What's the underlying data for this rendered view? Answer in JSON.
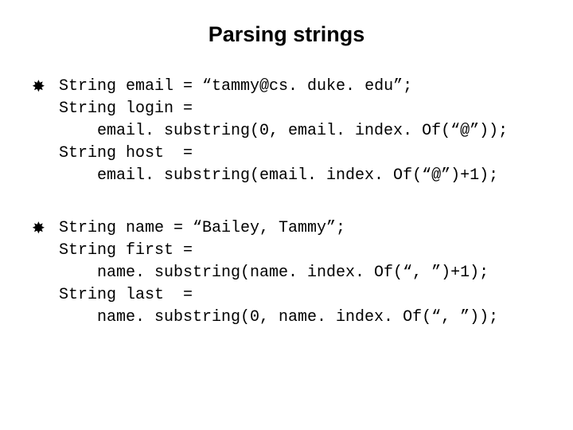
{
  "title": "Parsing strings",
  "block1": {
    "l1": "String email = “tammy@cs. duke. edu”;",
    "l2": "String login =",
    "l3": "email. substring(0, email. index. Of(“@”));",
    "l4": "String host  =",
    "l5": "email. substring(email. index. Of(“@”)+1);"
  },
  "block2": {
    "l1": "String name = “Bailey, Tammy”;",
    "l2": "String first =",
    "l3": "name. substring(name. index. Of(“, ”)+1);",
    "l4": "String last  =",
    "l5": "name. substring(0, name. index. Of(“, ”));"
  }
}
